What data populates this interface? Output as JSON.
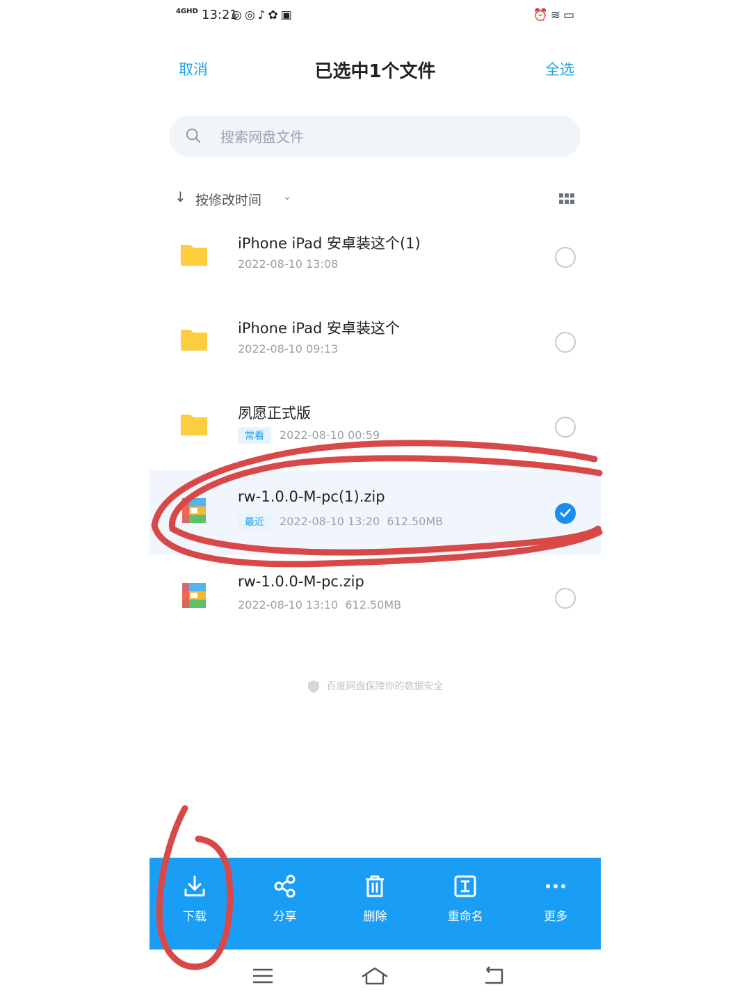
{
  "status_bar": {
    "network": "4GHD",
    "time": "13:21",
    "app_icons": [
      "weibo-icon",
      "weibo-icon",
      "tiktok-icon",
      "pinwheel-icon",
      "toutiao-icon"
    ],
    "right_icons": [
      "alarm-icon",
      "wifi-icon",
      "battery-icon"
    ]
  },
  "header": {
    "cancel_label": "取消",
    "title": "已选中1个文件",
    "select_all_label": "全选"
  },
  "search": {
    "placeholder": "搜索网盘文件"
  },
  "sort": {
    "label": "按修改时间"
  },
  "files": [
    {
      "name": "iPhone iPad 安卓装这个(1)",
      "date": "2022-08-10  13:08",
      "type": "folder",
      "tag": "",
      "size": "",
      "selected": false
    },
    {
      "name": "iPhone iPad 安卓装这个",
      "date": "2022-08-10  09:13",
      "type": "folder",
      "tag": "",
      "size": "",
      "selected": false
    },
    {
      "name": "夙愿正式版",
      "date": "2022-08-10  00:59",
      "type": "folder",
      "tag": "常看",
      "size": "",
      "selected": false
    },
    {
      "name": "rw-1.0.0-M-pc(1).zip",
      "date": "2022-08-10  13:20",
      "type": "archive",
      "tag": "最近",
      "size": "612.50MB",
      "selected": true
    },
    {
      "name": "rw-1.0.0-M-pc.zip",
      "date": "2022-08-10  13:10",
      "type": "archive",
      "tag": "",
      "size": "612.50MB",
      "selected": false
    }
  ],
  "footer": {
    "secure_text": "百度网盘保障你的数据安全"
  },
  "actions": [
    {
      "label": "下载",
      "icon": "download-icon"
    },
    {
      "label": "分享",
      "icon": "share-icon"
    },
    {
      "label": "删除",
      "icon": "trash-icon"
    },
    {
      "label": "重命名",
      "icon": "rename-icon"
    },
    {
      "label": "更多",
      "icon": "more-icon"
    }
  ],
  "colors": {
    "accent": "#1a9df5",
    "folder": "#fbcd3f",
    "annotation": "#d94848"
  }
}
